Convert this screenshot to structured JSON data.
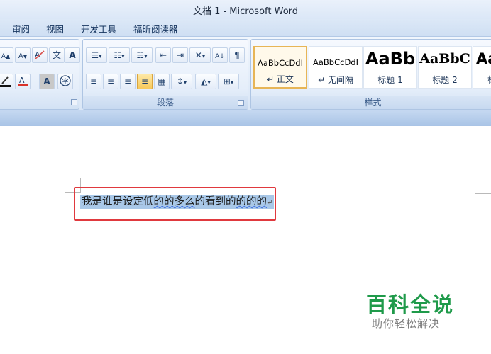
{
  "window": {
    "title": "文档 1 - Microsoft Word"
  },
  "menu": {
    "tabs": [
      "审阅",
      "视图",
      "开发工具",
      "福昕阅读器"
    ]
  },
  "ribbon": {
    "font_group": {
      "row1": [
        "A-grow-font",
        "A-shrink-font",
        "clear-format",
        "phonetic-guide",
        "char-border"
      ],
      "row2": [
        "highlight-pen",
        "font-color",
        "char-shading",
        "enclose-char"
      ]
    },
    "paragraph_group": {
      "label": "段落"
    },
    "styles_group": {
      "label": "样式",
      "tiles": [
        {
          "sample": "AaBbCcDdI",
          "name": "↵ 正文",
          "active": true
        },
        {
          "sample": "AaBbCcDdI",
          "name": "↵ 无间隔",
          "active": false
        },
        {
          "sample": "AaBb",
          "name": "标题 1",
          "active": false
        },
        {
          "sample": "AaBbC",
          "name": "标题 2",
          "active": false
        },
        {
          "sample": "Aa",
          "name": "标",
          "active": false
        }
      ]
    }
  },
  "document": {
    "selected_text_plain": "我是谁是设定低",
    "selected_text_squiggle": "的的多么",
    "selected_text_tail": "的看到的",
    "selected_text_squiggle2": "的的的",
    "paragraph_mark": "↵"
  },
  "watermark": {
    "title": "百科全说",
    "subtitle": "助你轻松解决"
  },
  "colors": {
    "selection": "#a9c8e8",
    "annotation_box": "#e0393e",
    "watermark_green": "#1f9a4a"
  }
}
